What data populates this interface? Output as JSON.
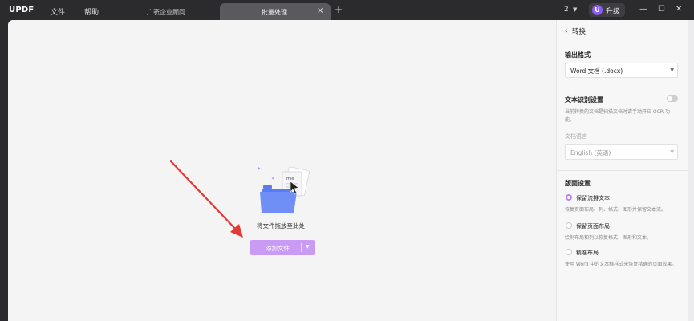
{
  "app": {
    "logo": "UPDF",
    "menu": [
      "文件",
      "帮助"
    ],
    "tabs": [
      {
        "label": "广袤企业顾问",
        "active": false
      },
      {
        "label": "批量处理",
        "active": true
      }
    ],
    "tab_close": "×",
    "tab_add": "+",
    "count": "2",
    "upgrade_label": "升级",
    "avatar_letter": "U",
    "window_controls": [
      "—",
      "☐",
      "✕"
    ],
    "accent_color": "#b884f2"
  },
  "main": {
    "drop_text": "将文件拖放至此处",
    "add_button_label": "添加文件"
  },
  "panel": {
    "title": "转换",
    "output_format": {
      "label": "输出格式",
      "value": "Word 文档 (.docx)"
    },
    "ocr": {
      "label": "文本识别设置",
      "enabled": false,
      "hint": "当前转换的文档是扫描文档时请手动开启 OCR 功能。",
      "language_label": "文档语言",
      "language_value": "English (英语)"
    },
    "layout": {
      "label": "版面设置",
      "options": [
        {
          "label": "保留流排文本",
          "desc": "恢复页面布局、列、格式、图形并保留文本流。",
          "selected": true
        },
        {
          "label": "保留页面布局",
          "desc": "绘制布局和列以恢复格式、图形和文本。",
          "selected": false
        },
        {
          "label": "精准布局",
          "desc": "使用 Word 中的文本框样式来恢复精确的页面效果。",
          "selected": false
        }
      ]
    }
  }
}
